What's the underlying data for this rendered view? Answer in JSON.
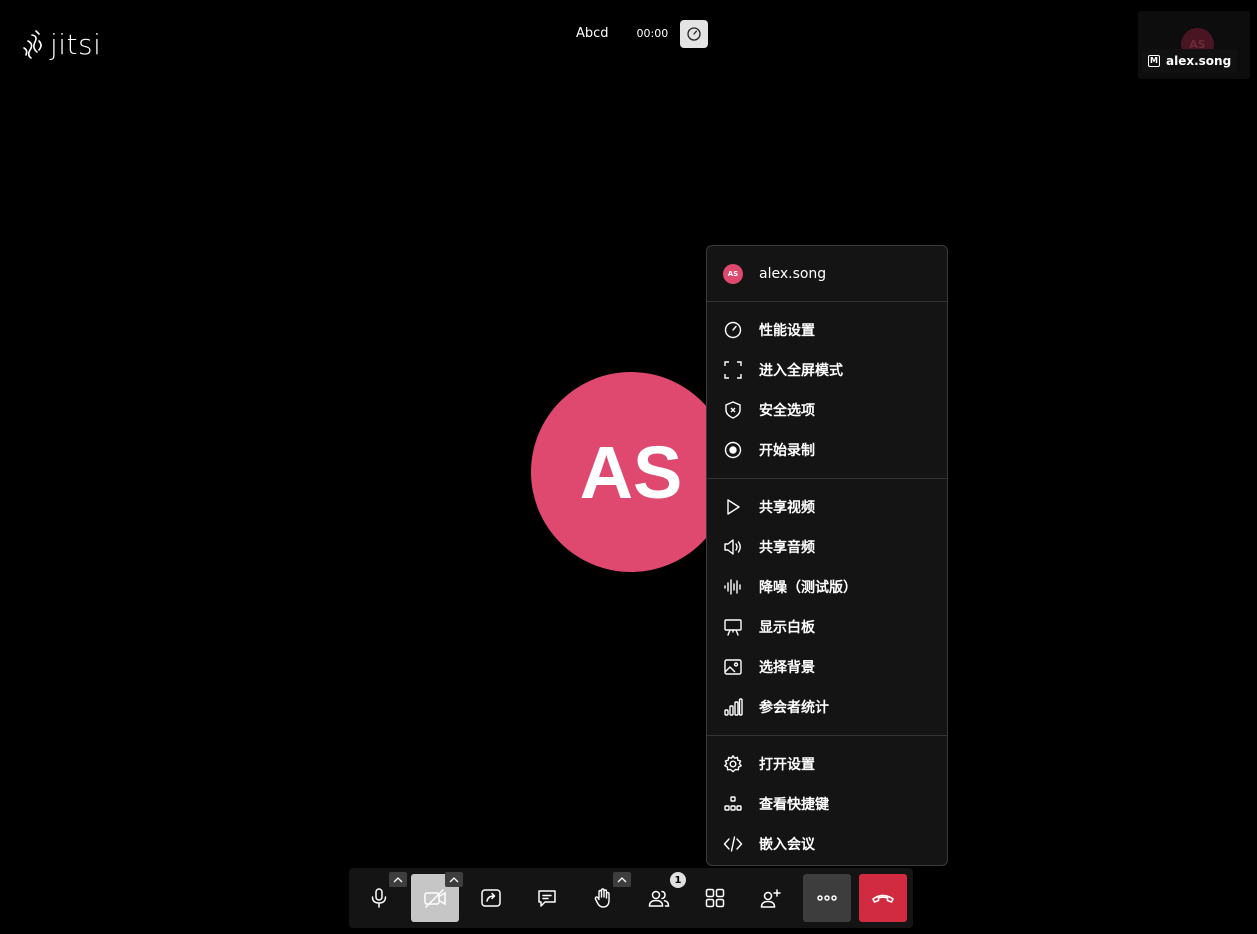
{
  "logo": {
    "text": "jitsi"
  },
  "header": {
    "meeting_title": "Abcd",
    "timer": "00:00"
  },
  "filmstrip": {
    "avatar_initials": "AS",
    "moderator_badge": "M",
    "display_name": "alex.song"
  },
  "main": {
    "avatar_initials": "AS"
  },
  "overflow_menu": {
    "user": {
      "initials": "AS",
      "name": "alex.song"
    },
    "groups": [
      [
        {
          "label": "性能设置",
          "icon": "gauge-icon"
        },
        {
          "label": "进入全屏模式",
          "icon": "fullscreen-icon"
        },
        {
          "label": "安全选项",
          "icon": "shield-icon"
        },
        {
          "label": "开始录制",
          "icon": "record-icon"
        }
      ],
      [
        {
          "label": "共享视频",
          "icon": "play-icon"
        },
        {
          "label": "共享音频",
          "icon": "speaker-icon"
        },
        {
          "label": "降噪（测试版）",
          "icon": "waveform-icon"
        },
        {
          "label": "显示白板",
          "icon": "whiteboard-icon"
        },
        {
          "label": "选择背景",
          "icon": "image-icon"
        },
        {
          "label": "参会者统计",
          "icon": "stats-bars-icon"
        }
      ],
      [
        {
          "label": "打开设置",
          "icon": "gear-icon"
        },
        {
          "label": "查看快捷键",
          "icon": "shortcuts-icon"
        },
        {
          "label": "嵌入会议",
          "icon": "code-icon"
        }
      ]
    ]
  },
  "toolbar": {
    "participants_count": "1"
  },
  "colors": {
    "avatar": "#df486f",
    "hangup": "#d02b40",
    "toolbar_bg": "#141414",
    "menu_bg": "#141414"
  }
}
